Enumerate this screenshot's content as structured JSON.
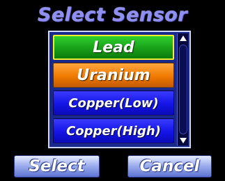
{
  "title": "Select Sensor",
  "sensor_list": {
    "selected_index": 0,
    "items": [
      {
        "label": "Lead",
        "color": "#1aa31a"
      },
      {
        "label": "Uranium",
        "color": "#f07a00"
      },
      {
        "label": "Copper(Low)",
        "color": "#1414e6"
      },
      {
        "label": "Copper(High)",
        "color": "#1414e6"
      }
    ],
    "scroll_up_icon": "triangle-up",
    "scroll_down_icon": "triangle-down"
  },
  "buttons": {
    "select_label": "Select",
    "cancel_label": "Cancel"
  },
  "colors": {
    "background": "#000000",
    "title": "#8e8ff0",
    "selected_highlight": "#f2ef2a"
  }
}
